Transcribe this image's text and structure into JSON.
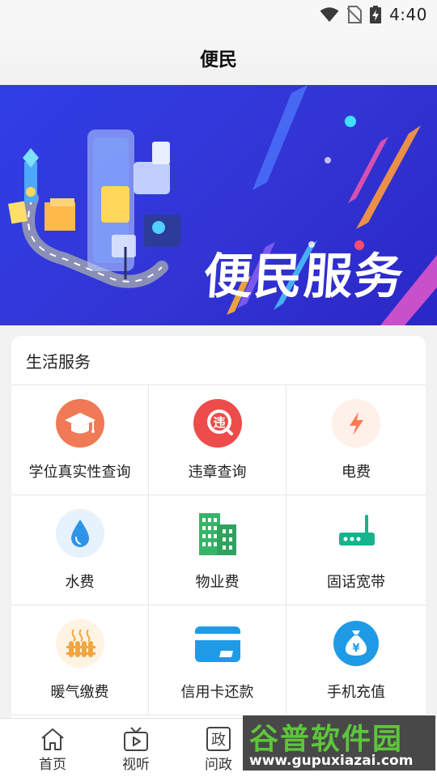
{
  "status": {
    "time": "4:40"
  },
  "header": {
    "title": "便民"
  },
  "banner": {
    "title": "便民服务",
    "slide_count": 2,
    "active_slide": 2
  },
  "life_services": {
    "heading": "生活服务",
    "items": [
      {
        "label": "学位真实性查询",
        "icon": "graduation-cap-icon",
        "color": "#f07a55"
      },
      {
        "label": "违章查询",
        "icon": "traffic-violation-icon",
        "color": "#ee4b4b"
      },
      {
        "label": "电费",
        "icon": "lightning-icon",
        "color": "#ff7a55"
      },
      {
        "label": "水费",
        "icon": "water-drop-icon",
        "color": "#2f93e8"
      },
      {
        "label": "物业费",
        "icon": "buildings-icon",
        "color": "#36b46a"
      },
      {
        "label": "固话宽带",
        "icon": "router-icon",
        "color": "#18b38c"
      },
      {
        "label": "暖气缴费",
        "icon": "heater-icon",
        "color": "#f2a640"
      },
      {
        "label": "信用卡还款",
        "icon": "credit-card-icon",
        "color": "#1f9be6"
      },
      {
        "label": "手机充值",
        "icon": "money-bag-icon",
        "color": "#1f9be6"
      }
    ]
  },
  "tabbar": {
    "tabs": [
      {
        "label": "首页",
        "icon": "home-icon"
      },
      {
        "label": "视听",
        "icon": "tv-icon"
      },
      {
        "label": "问政",
        "icon": "politics-icon",
        "glyph": "政"
      }
    ]
  },
  "watermark": {
    "title": "谷普软件园",
    "url": "www.gupuxiazai.com"
  }
}
